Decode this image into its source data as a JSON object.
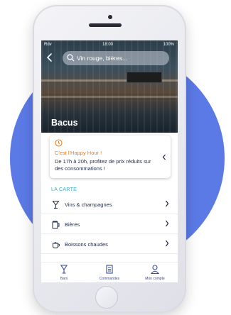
{
  "status_bar": {
    "carrier": "Rdv",
    "time": "18:00",
    "battery": "100%"
  },
  "search": {
    "placeholder": "Vin rouge, bières..."
  },
  "venue": {
    "name": "Bacus"
  },
  "happy_hour": {
    "title": "C'est l'Happy Hour !",
    "description": "De 17h à 20h, profitez de prix réduits sur des consommations !"
  },
  "menu": {
    "section_label": "LA CARTE",
    "items": [
      {
        "label": "Vins & champagnes",
        "icon": "wine-glass-icon"
      },
      {
        "label": "Bières",
        "icon": "beer-mug-icon"
      },
      {
        "label": "Boissons chaudes",
        "icon": "teapot-icon"
      }
    ]
  },
  "tabs": [
    {
      "label": "Bars",
      "icon": "cocktail-icon"
    },
    {
      "label": "Commandes",
      "icon": "receipt-icon"
    },
    {
      "label": "Mon compte",
      "icon": "user-icon"
    }
  ],
  "colors": {
    "accent_orange": "#ef7d22",
    "section_teal": "#3ba8c4",
    "tab_blue": "#3a4a9c",
    "background_circle": "#5b7ae6"
  }
}
